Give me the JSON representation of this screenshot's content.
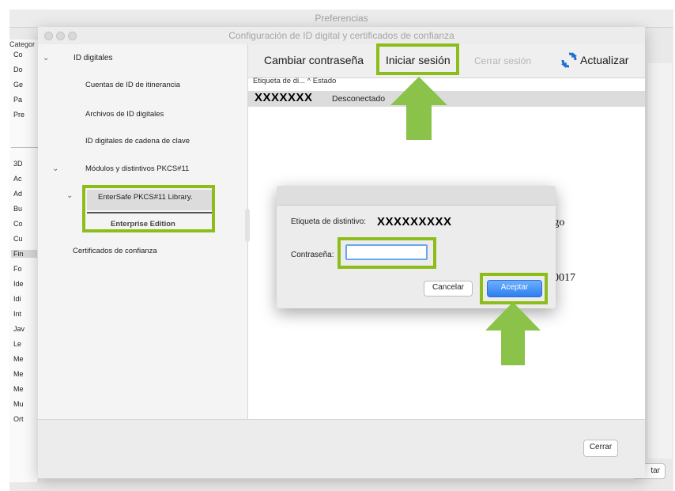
{
  "prefs": {
    "title": "Preferencias",
    "category_header": "Categor",
    "categories": [
      "Co",
      "Do",
      "Ge",
      "Pa",
      "Pre",
      "3D",
      "Ac",
      "Ad",
      "Bu",
      "Co",
      "Cu",
      "Fin",
      "Fo",
      "Ide",
      "Idi",
      "Int",
      "Jav",
      "Le",
      "Me",
      "Me",
      "Me",
      "Mu",
      "Ort"
    ],
    "partial_button": "tar"
  },
  "dialog": {
    "title": "Configuración de ID digital y certificados de confianza",
    "tree": {
      "digital_ids": "ID digitales",
      "roaming": "Cuentas de ID de itinerancia",
      "files": "Archivos de ID digitales",
      "keychain": "ID digitales de cadena de clave",
      "pkcs_modules": "Módulos y distintivos PKCS#11",
      "entersafe": "EnterSafe PKCS#11 Library.",
      "token": "Enterprise Edition",
      "trusted": "Certificados de confianza"
    },
    "toolbar": {
      "change_password": "Cambiar contraseña",
      "login": "Iniciar sesión",
      "logout": "Cerrar sesión",
      "refresh": "Actualizar"
    },
    "list": {
      "header": "Etiqueta de di...  ^  Estado",
      "row_label": "XXXXXXX",
      "row_status": "Desconectado"
    },
    "behind": {
      "text1": "rgo",
      "text2": "0017"
    },
    "close_label": "Cerrar"
  },
  "modal": {
    "token_label": "Etiqueta de distintivo:",
    "token_value": "XXXXXXXXX",
    "password_label": "Contraseña:",
    "password_value": "",
    "cancel": "Cancelar",
    "accept": "Aceptar"
  },
  "colors": {
    "highlight": "#8dbd1b",
    "arrow": "#8bc34a",
    "accent_button": "#2f7ef0"
  }
}
